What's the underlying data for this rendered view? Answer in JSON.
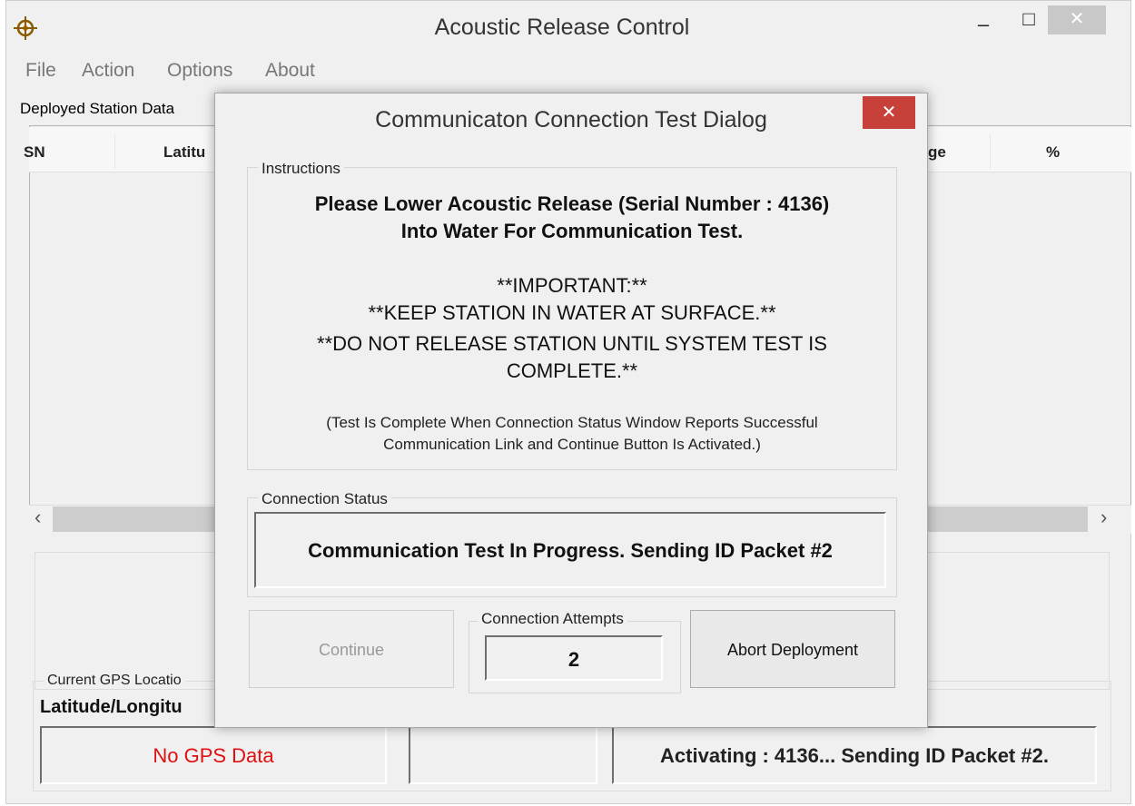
{
  "window": {
    "title": "Acoustic Release Control",
    "minimize_glyph": "–",
    "maximize_glyph": "□",
    "close_glyph": "✕",
    "app_icon": "crosshair-icon"
  },
  "menu": {
    "items": [
      {
        "label": "File"
      },
      {
        "label": "Action"
      },
      {
        "label": "Options"
      },
      {
        "label": "About"
      }
    ]
  },
  "deployed": {
    "tab_label": "Deployed Station Data",
    "columns": [
      "SN",
      "Latitu",
      "ge",
      "%"
    ]
  },
  "scrollbar": {
    "left_glyph": "‹",
    "right_glyph": "›"
  },
  "gps": {
    "group_label": "Current GPS Locatio",
    "latlon_label": "Latitude/Longitu",
    "value": "No GPS Data",
    "status": "Activating : 4136... Sending ID Packet #2."
  },
  "dialog": {
    "title": "Communicaton Connection Test Dialog",
    "close_glyph": "✕",
    "instructions_label": "Instructions",
    "lines": [
      "Please Lower Acoustic Release (Serial Number : 4136)",
      "Into Water For Communication Test.",
      "**IMPORTANT:**",
      "**KEEP STATION IN WATER AT SURFACE.**",
      "**DO NOT RELEASE STATION UNTIL SYSTEM TEST IS",
      "COMPLETE.**"
    ],
    "note_lines": [
      "(Test Is Complete When Connection Status Window Reports Successful",
      "Communication Link and Continue Button Is Activated.)"
    ],
    "status_label": "Connection Status",
    "status_text": "Communication Test In Progress. Sending ID Packet #2",
    "continue_label": "Continue",
    "attempts_label": "Connection Attempts",
    "attempts_value": "2",
    "abort_label": "Abort Deployment"
  },
  "colors": {
    "dialog_close": "#c7403a",
    "gps_error": "#e01010"
  }
}
